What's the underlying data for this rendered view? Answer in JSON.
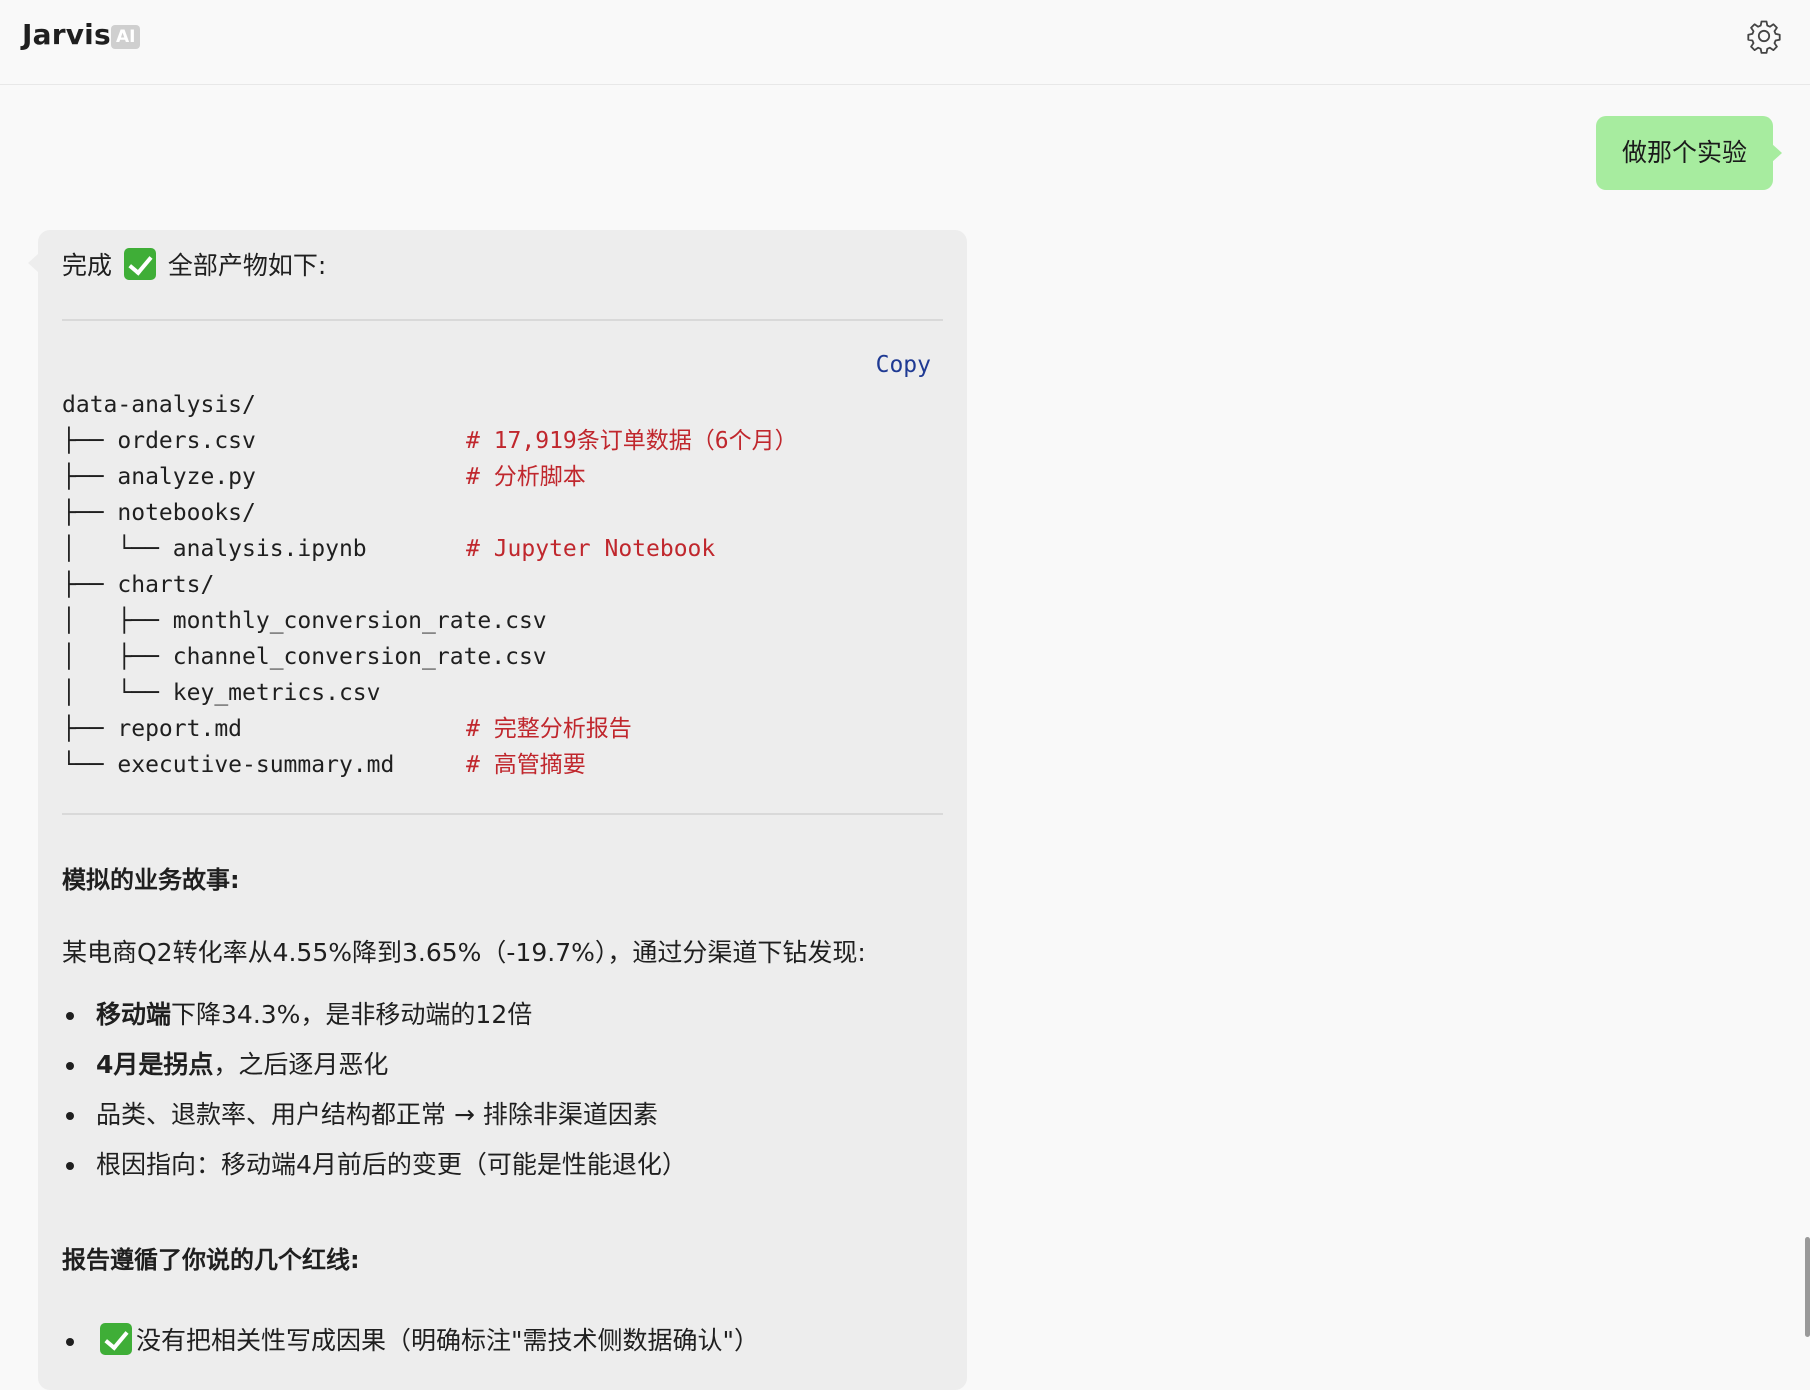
{
  "header": {
    "title": "Jarvis",
    "badge": "AI",
    "settings_icon": "gear-icon"
  },
  "user_message": "做那个实验",
  "assistant": {
    "intro_before": "完成",
    "intro_emoji": "check-mark-button-emoji",
    "intro_after": "全部产物如下:",
    "code": {
      "copy_label": "Copy",
      "lines": [
        {
          "path": "data-analysis/",
          "comment": ""
        },
        {
          "path": "├── orders.csv",
          "comment": "# 17,919条订单数据（6个月）"
        },
        {
          "path": "├── analyze.py",
          "comment": "# 分析脚本"
        },
        {
          "path": "├── notebooks/",
          "comment": ""
        },
        {
          "path": "│   └── analysis.ipynb",
          "comment": "# Jupyter Notebook"
        },
        {
          "path": "├── charts/",
          "comment": ""
        },
        {
          "path": "│   ├── monthly_conversion_rate.csv",
          "comment": ""
        },
        {
          "path": "│   ├── channel_conversion_rate.csv",
          "comment": ""
        },
        {
          "path": "│   └── key_metrics.csv",
          "comment": ""
        },
        {
          "path": "├── report.md",
          "comment": "# 完整分析报告"
        },
        {
          "path": "└── executive-summary.md",
          "comment": "# 高管摘要"
        }
      ]
    },
    "story_title": "模拟的业务故事:",
    "story_text": "某电商Q2转化率从4.55%降到3.65%（-19.7%），通过分渠道下钻发现:",
    "story_bullets": [
      {
        "bold": "移动端",
        "text": "下降34.3%，是非移动端的12倍"
      },
      {
        "bold": "4月是拐点",
        "text": "，之后逐月恶化"
      },
      {
        "bold": "",
        "text": "品类、退款率、用户结构都正常 → 排除非渠道因素"
      },
      {
        "bold": "",
        "text": "根因指向：移动端4月前后的变更（可能是性能退化）"
      }
    ],
    "redline_title": "报告遵循了你说的几个红线:",
    "redline_bullets": [
      {
        "text": "没有把相关性写成因果（明确标注\"需技术侧数据确认\"）"
      }
    ]
  }
}
